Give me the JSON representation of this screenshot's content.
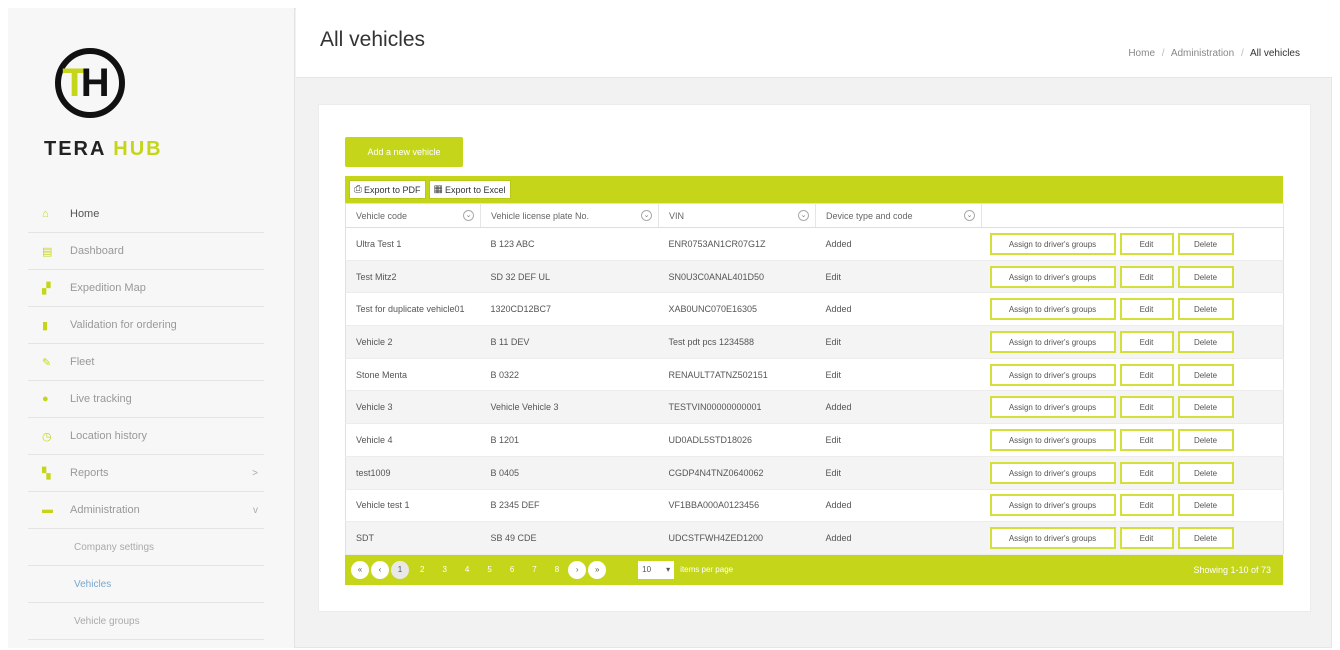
{
  "brand": {
    "left": "TERA",
    "right": "HUB"
  },
  "sidebar": {
    "items": [
      {
        "icon": "home-icon",
        "glyph": "⌂",
        "label": "Home"
      },
      {
        "icon": "chart-icon",
        "glyph": "▤",
        "label": "Dashboard"
      },
      {
        "icon": "map-icon",
        "glyph": "▞",
        "label": "Expedition Map"
      },
      {
        "icon": "bar-icon",
        "glyph": "▮",
        "label": "Validation for ordering"
      },
      {
        "icon": "wrench-icon",
        "glyph": "✎",
        "label": "Fleet"
      },
      {
        "icon": "dot-icon",
        "glyph": "●",
        "label": "Live tracking"
      },
      {
        "icon": "clock-icon",
        "glyph": "◷",
        "label": "Location history"
      },
      {
        "icon": "report-icon",
        "glyph": "▚",
        "label": "Reports",
        "chevron": ">"
      },
      {
        "icon": "admin-icon",
        "glyph": "▬",
        "label": "Administration",
        "chevron": "v"
      }
    ],
    "subitems": [
      {
        "label": "Company settings"
      },
      {
        "label": "Vehicles"
      },
      {
        "label": "Vehicle groups"
      }
    ]
  },
  "header": {
    "title": "All vehicles",
    "breadcrumbs": [
      "Home",
      "Administration",
      "All vehicles"
    ]
  },
  "main": {
    "add_label": "Add a new vehicle",
    "export_pdf": "Export to PDF",
    "export_excel": "Export to Excel",
    "columns": [
      "Vehicle code",
      "Vehicle license plate No.",
      "VIN",
      "Device type and code"
    ],
    "rows": [
      [
        "Ultra Test 1",
        "B 123 ABC",
        "ENR0753AN1CR07G1Z",
        "Added"
      ],
      [
        "Test Mitz2",
        "SD 32 DEF UL",
        "SN0U3C0ANAL401D50",
        "Edit"
      ],
      [
        "Test for duplicate vehicle01",
        "1320CD12BC7",
        "XAB0UNC070E16305",
        "Added"
      ],
      [
        "Vehicle 2",
        "B 11 DEV",
        "Test pdt pcs 1234588",
        "Edit"
      ],
      [
        "Stone Menta",
        "B 0322",
        "RENAULT7ATNZ502151",
        "Edit"
      ],
      [
        "Vehicle 3",
        "Vehicle Vehicle 3",
        "TESTVIN00000000001",
        "Added"
      ],
      [
        "Vehicle 4",
        "B 1201",
        "UD0ADL5STD18026",
        "Edit"
      ],
      [
        "test1009",
        "B 0405",
        "CGDP4N4TNZ0640062",
        "Edit"
      ],
      [
        "Vehicle test 1",
        "B 2345 DEF",
        "VF1BBA000A0123456",
        "Added"
      ],
      [
        "SDT",
        "SB 49 CDE",
        "UDCSTFWH4ZED1200",
        "Added"
      ]
    ],
    "actions": {
      "assign": "Assign to driver's groups",
      "edit": "Edit",
      "delete": "Delete"
    },
    "pager": {
      "first": "«",
      "prev": "‹",
      "current": "1",
      "pages": [
        "2",
        "3",
        "4",
        "5",
        "6",
        "7",
        "8"
      ],
      "next": "›",
      "last": "»",
      "per_page": "10",
      "per_page_label": "items per page",
      "showing": "Showing 1-10 of 73"
    }
  },
  "colors": {
    "accent": "#c5d61a",
    "link": "#7aa7cf"
  }
}
